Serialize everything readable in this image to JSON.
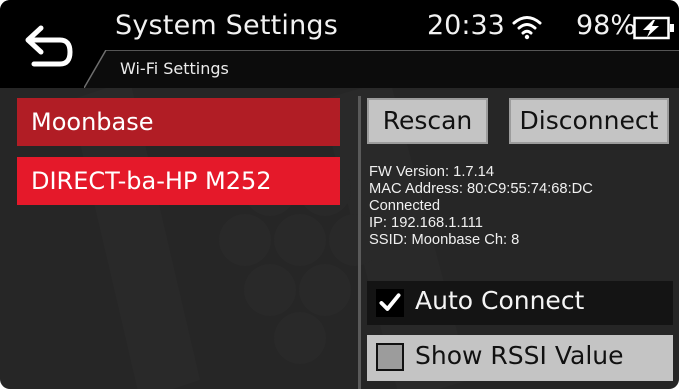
{
  "header": {
    "title": "System Settings",
    "subtitle": "Wi-Fi Settings",
    "time": "20:33",
    "battery": "98%",
    "icons": [
      "back-arrow-icon",
      "wifi-icon",
      "battery-charging-icon"
    ]
  },
  "networks": [
    {
      "name": "Moonbase",
      "selected": true
    },
    {
      "name": "DIRECT-ba-HP M252",
      "selected": false
    }
  ],
  "buttons": {
    "rescan": "Rescan",
    "disconnect": "Disconnect"
  },
  "info": {
    "fw_version": "FW Version: 1.7.14",
    "mac": "MAC Address: 80:C9:55:74:68:DC",
    "status": "Connected",
    "ip": "IP: 192.168.1.111",
    "ssid": "SSID: Moonbase Ch: 8"
  },
  "options": {
    "auto_connect": {
      "label": "Auto Connect",
      "checked": true
    },
    "show_rssi": {
      "label": "Show RSSI Value",
      "checked": false
    }
  },
  "colors": {
    "background": "#262626",
    "header": "#000000",
    "selected_network": "#b11d25",
    "network": "#e5192a",
    "button": "#c4c4c4"
  }
}
